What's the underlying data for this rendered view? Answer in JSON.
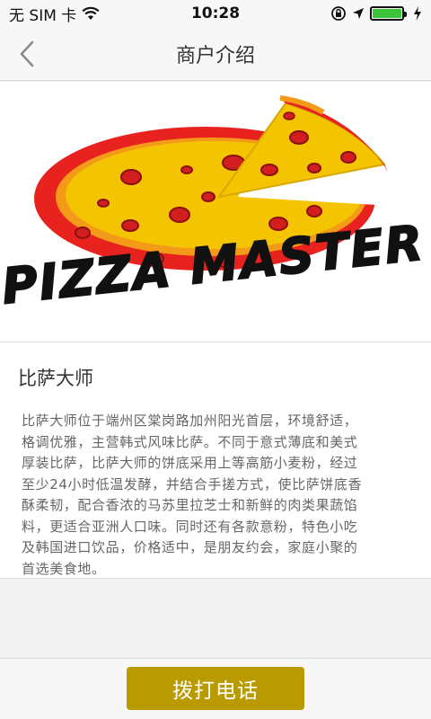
{
  "status_bar": {
    "carrier": "无 SIM 卡",
    "time": "10:28",
    "battery_level": 1.0,
    "icons": [
      "wifi-icon",
      "rotation-lock-icon",
      "location-arrow-icon",
      "battery-icon",
      "charging-bolt-icon"
    ]
  },
  "nav": {
    "title": "商户介绍",
    "back_icon": "chevron-left-icon"
  },
  "logo": {
    "text": "PIZZA MASTER",
    "colors": {
      "red": "#e8231f",
      "yellow": "#f5c400",
      "orange": "#f39a18",
      "pepperoni": "#d21e1e",
      "ink": "#111111"
    }
  },
  "shop": {
    "name": "比萨大师",
    "description_lines": [
      "比萨大师位于端州区棠岗路加州阳光首层，环境舒适，",
      "格调优雅，主营韩式风味比萨。不同于意式薄底和美式",
      "厚装比萨，比萨大师的饼底采用上等高筋小麦粉，经过",
      "至少24小时低温发酵，并结合手搓方式，使比萨饼底香",
      "酥柔韧，配合香浓的马苏里拉芝士和新鲜的肉类果蔬馅",
      "料，更适合亚洲人口味。同时还有各款意粉，特色小吃",
      "及韩国进口饮品，价格适中，是朋友约会，家庭小聚的",
      "首选美食地。"
    ]
  },
  "actions": {
    "call_label": "拨打电话"
  },
  "theme": {
    "accent": "#b99a00"
  }
}
